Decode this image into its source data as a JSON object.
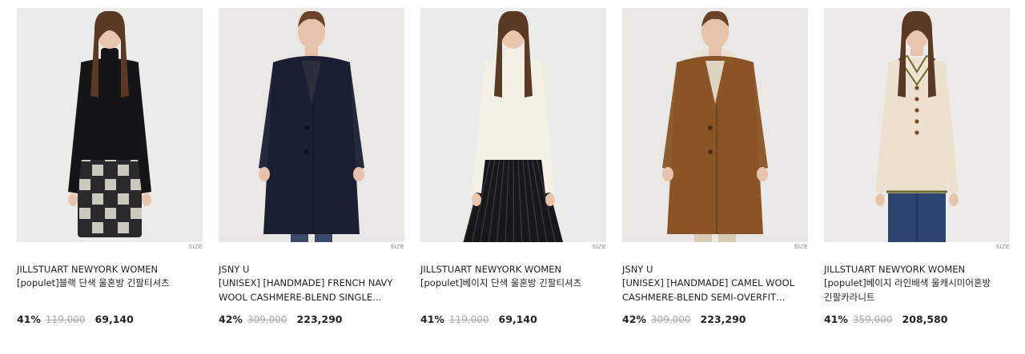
{
  "products": [
    {
      "brand": "JILLSTUART NEWYORK WOMEN",
      "name": "[populet]블랙 단색 울혼방 긴팔티셔츠",
      "discount": "41%",
      "original_price": "119,000",
      "final_price": "69,140",
      "size_label": "SIZE",
      "image": {
        "bg": "#ebebea",
        "skin": "#e9c5ad",
        "hair": "#5a3a24",
        "top": "#151517",
        "bottom": "#2a2a2d",
        "bottom_accent": "#e8e4da",
        "legs": "#cfb59f"
      }
    },
    {
      "brand": "JSNY U",
      "name": "[UNISEX] [HANDMADE] FRENCH NAVY WOOL CASHMERE-BLEND SINGLE COAT",
      "discount": "42%",
      "original_price": "309,000",
      "final_price": "223,290",
      "size_label": "SIZE",
      "image": {
        "bg": "#eae8e4",
        "skin": "#e6c3aa",
        "hair": "#6a4228",
        "top": "#1a1f33",
        "bottom": "#3a4a6b",
        "bottom_accent": "#6f7fa6",
        "legs": "#3a4a6b"
      }
    },
    {
      "brand": "JILLSTUART NEWYORK WOMEN",
      "name": "[populet]베이지 단색 울혼방 긴팔티셔츠",
      "discount": "41%",
      "original_price": "119,000",
      "final_price": "69,140",
      "size_label": "SIZE",
      "image": {
        "bg": "#ebebea",
        "skin": "#e9c5ad",
        "hair": "#5a3a24",
        "top": "#f3f0e6",
        "bottom": "#17171a",
        "bottom_accent": "#3b3b40",
        "legs": "#17171a"
      }
    },
    {
      "brand": "JSNY U",
      "name": "[UNISEX] [HANDMADE] CAMEL WOOL CASHMERE-BLEND SEMI-OVERFIT COAT",
      "discount": "42%",
      "original_price": "309,000",
      "final_price": "223,290",
      "size_label": "SIZE",
      "image": {
        "bg": "#eae8e4",
        "skin": "#e6c3aa",
        "hair": "#6a4228",
        "top": "#8a5426",
        "bottom": "#d8cdb3",
        "bottom_accent": "#c9bc9d",
        "legs": "#d8cdb3"
      }
    },
    {
      "brand": "JILLSTUART NEWYORK WOMEN",
      "name": "[populet]베이지 라인배색 울캐시미어혼방 긴팔카라니트",
      "discount": "41%",
      "original_price": "359,000",
      "final_price": "208,580",
      "size_label": "SIZE",
      "image": {
        "bg": "#ecebe9",
        "skin": "#e9c5ad",
        "hair": "#5a3a24",
        "top": "#ece1cf",
        "bottom": "#2e4470",
        "bottom_accent": "#6b6a2e",
        "legs": "#2e4470"
      }
    }
  ]
}
